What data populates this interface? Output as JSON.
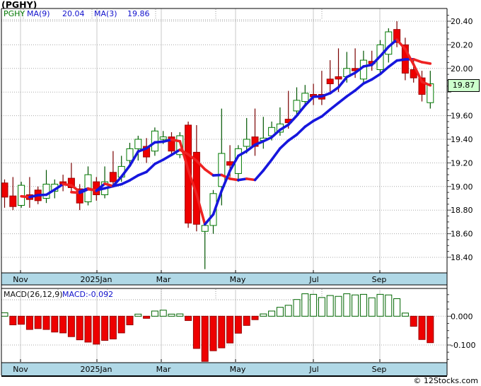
{
  "title": "(PGHY)",
  "copyright": "© 12Stocks.com",
  "price_panel": {
    "legend": {
      "symbol": "PGHY",
      "ma9_label": "MA(9)",
      "ma9_value": "20.04",
      "ma3_label": "MA(3)",
      "ma3_value": "19.86"
    },
    "y_axis_labels": [
      "20.40",
      "20.20",
      "20.00",
      "19.60",
      "19.40",
      "19.20",
      "19.00",
      "18.80",
      "18.60",
      "18.40"
    ],
    "y_axis_values": [
      20.4,
      20.2,
      20.0,
      19.6,
      19.4,
      19.2,
      19.0,
      18.8,
      18.6,
      18.4
    ],
    "last_price_badge": "19.87"
  },
  "macd_panel": {
    "legend_label": "MACD(26,12,9)",
    "legend_value": "MACD:-0.092",
    "y_axis_labels": [
      "0.000",
      "-0.100"
    ],
    "y_axis_values": [
      0.0,
      -0.1
    ]
  },
  "colors": {
    "up_border": "#007A00",
    "up_fill": "#FFFFFF",
    "up_wick": "#005500",
    "down_fill": "#EE0000",
    "down_border": "#A00000",
    "down_wick": "#7A0000",
    "ma_up": "#1616DD",
    "ma_down": "#EE2222",
    "grid": "#AAAAAA",
    "month_grid": "#C9C9C9",
    "border": "#000000",
    "band_fill": "#B0D8E6",
    "badge_bg": "#CCFFCC",
    "legend_green": "#007700",
    "legend_blue": "#1111CC",
    "macd_pos_border": "#006600",
    "macd_pos_fill": "#FFFFFF",
    "macd_neg_fill": "#EE0000",
    "macd_neg_border": "#990000"
  },
  "chart_data": {
    "type": "candlestick",
    "symbol": "PGHY",
    "frequency": "weekly",
    "months": [
      "Nov",
      "2025Jan",
      "Mar",
      "May",
      "Jul",
      "Sep"
    ],
    "month_x": [
      29,
      137,
      228,
      333,
      443,
      537
    ],
    "month_label_x": [
      29,
      136,
      231,
      336,
      444,
      536
    ],
    "price_ylim": [
      18.27,
      20.51
    ],
    "last_price": 19.87,
    "candles": [
      [
        19.03,
        19.06,
        18.82,
        18.91
      ],
      [
        18.92,
        19.08,
        18.8,
        18.83
      ],
      [
        18.84,
        19.04,
        18.82,
        19.01
      ],
      [
        18.93,
        19.08,
        18.82,
        18.89
      ],
      [
        18.97,
        19.0,
        18.85,
        18.88
      ],
      [
        18.9,
        19.14,
        18.86,
        19.02
      ],
      [
        18.96,
        19.06,
        18.9,
        19.02
      ],
      [
        19.04,
        19.1,
        18.96,
        19.02
      ],
      [
        19.07,
        19.2,
        18.95,
        18.99
      ],
      [
        18.98,
        19.02,
        18.8,
        18.86
      ],
      [
        18.87,
        19.17,
        18.84,
        19.1
      ],
      [
        19.04,
        19.08,
        18.88,
        18.93
      ],
      [
        18.93,
        19.17,
        18.9,
        19.04
      ],
      [
        19.12,
        19.3,
        19.0,
        19.04
      ],
      [
        19.08,
        19.26,
        19.04,
        19.17
      ],
      [
        19.22,
        19.37,
        19.18,
        19.32
      ],
      [
        19.32,
        19.43,
        19.22,
        19.4
      ],
      [
        19.34,
        19.41,
        19.2,
        19.25
      ],
      [
        19.3,
        19.5,
        19.26,
        19.47
      ],
      [
        19.4,
        19.47,
        19.36,
        19.42
      ],
      [
        19.42,
        19.46,
        19.26,
        19.3
      ],
      [
        19.27,
        19.46,
        19.24,
        19.43
      ],
      [
        19.52,
        19.55,
        18.65,
        18.69
      ],
      [
        19.29,
        19.52,
        18.62,
        18.68
      ],
      [
        18.62,
        18.7,
        18.3,
        18.67
      ],
      [
        18.67,
        18.97,
        18.6,
        18.94
      ],
      [
        19.0,
        19.66,
        18.84,
        19.28
      ],
      [
        19.21,
        19.35,
        19.08,
        19.18
      ],
      [
        19.11,
        19.35,
        19.04,
        19.32
      ],
      [
        19.34,
        19.58,
        19.28,
        19.4
      ],
      [
        19.42,
        19.66,
        19.26,
        19.34
      ],
      [
        19.39,
        19.59,
        19.32,
        19.41
      ],
      [
        19.43,
        19.55,
        19.39,
        19.5
      ],
      [
        19.46,
        19.67,
        19.43,
        19.53
      ],
      [
        19.57,
        19.81,
        19.49,
        19.54
      ],
      [
        19.64,
        19.84,
        19.6,
        19.73
      ],
      [
        19.72,
        19.86,
        19.68,
        19.79
      ],
      [
        19.78,
        19.87,
        19.69,
        19.76
      ],
      [
        19.78,
        19.98,
        19.69,
        19.74
      ],
      [
        19.91,
        20.07,
        19.78,
        19.87
      ],
      [
        19.93,
        20.17,
        19.8,
        19.91
      ],
      [
        19.93,
        20.14,
        19.88,
        20.0
      ],
      [
        20.0,
        20.17,
        19.92,
        19.98
      ],
      [
        19.91,
        20.15,
        19.88,
        20.07
      ],
      [
        20.06,
        20.15,
        19.98,
        20.04
      ],
      [
        19.99,
        20.24,
        19.95,
        20.2
      ],
      [
        20.12,
        20.34,
        20.05,
        20.31
      ],
      [
        20.33,
        20.4,
        20.18,
        20.22
      ],
      [
        20.2,
        20.26,
        19.9,
        19.96
      ],
      [
        19.99,
        20.08,
        19.88,
        19.92
      ],
      [
        19.92,
        19.98,
        19.72,
        19.78
      ],
      [
        19.71,
        19.98,
        19.66,
        19.87
      ]
    ],
    "overlays": [
      {
        "name": "MA(9)",
        "period": 9,
        "last": 20.04
      },
      {
        "name": "MA(3)",
        "period": 3,
        "last": 19.86
      }
    ],
    "macd": {
      "params": "26,12,9",
      "last": -0.092,
      "ylim": [
        -0.159,
        0.092
      ],
      "histogram": [
        0.012,
        -0.03,
        -0.028,
        -0.046,
        -0.043,
        -0.046,
        -0.055,
        -0.058,
        -0.071,
        -0.082,
        -0.09,
        -0.097,
        -0.084,
        -0.079,
        -0.058,
        -0.03,
        0.004,
        -0.003,
        0.018,
        0.021,
        0.006,
        0.008,
        -0.015,
        -0.112,
        -0.157,
        -0.12,
        -0.11,
        -0.093,
        -0.059,
        -0.032,
        -0.012,
        0.008,
        0.018,
        0.031,
        0.038,
        0.058,
        0.078,
        0.076,
        0.065,
        0.072,
        0.069,
        0.078,
        0.074,
        0.076,
        0.064,
        0.076,
        0.074,
        0.061,
        0.011,
        -0.035,
        -0.081,
        -0.092
      ]
    }
  }
}
